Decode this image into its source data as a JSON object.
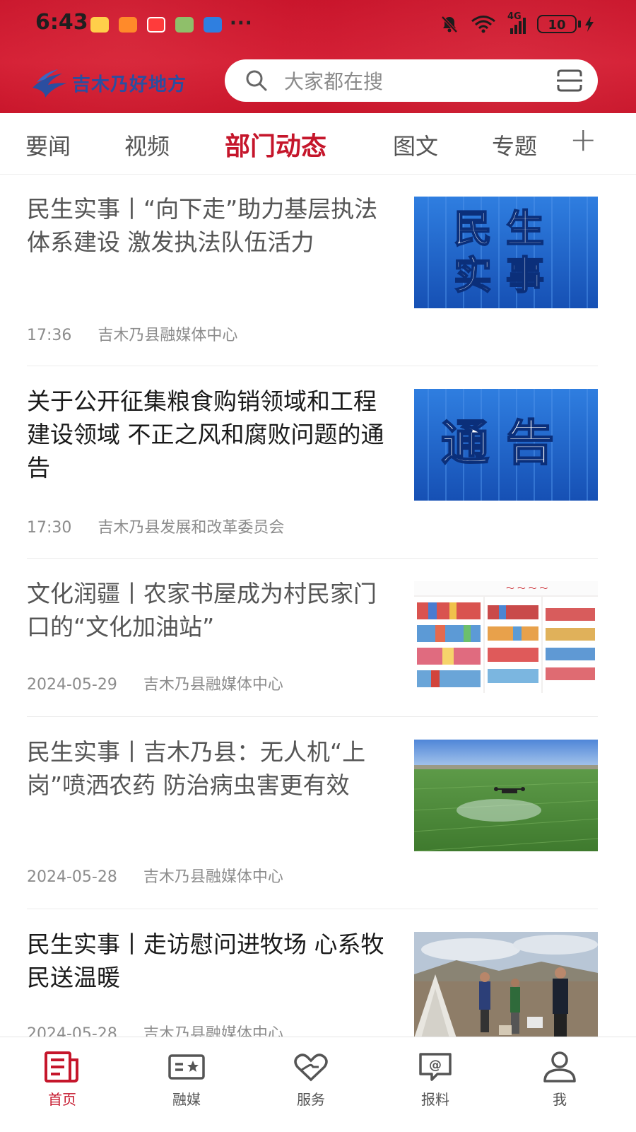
{
  "status_bar": {
    "time": "6:43",
    "more": "···",
    "network": "4G",
    "battery": "10"
  },
  "header": {
    "logo_text": "吉木乃好地方",
    "search_placeholder": "大家都在搜"
  },
  "tabs": [
    {
      "label": "要闻",
      "active": false
    },
    {
      "label": "视频",
      "active": false
    },
    {
      "label": "部门动态",
      "active": true
    },
    {
      "label": "图文",
      "active": false
    },
    {
      "label": "专题",
      "active": false
    }
  ],
  "tab_add": "+",
  "articles": [
    {
      "title": "民生实事丨“向下走”助力基层执法体系建设 激发执法队伍活力",
      "time": "17:36",
      "source": "吉木乃县融媒体中心",
      "thumb": {
        "type": "text-banner",
        "text": "民 生\n实 事"
      }
    },
    {
      "title": "关于公开征集粮食购销领域和工程建设领域 不正之风和腐败问题的通告",
      "time": "17:30",
      "source": "吉木乃县发展和改革委员会",
      "thumb": {
        "type": "text-banner",
        "text": "通 告"
      }
    },
    {
      "title": "文化润疆丨农家书屋成为村民家门口的“文化加油站”",
      "time": "2024-05-29",
      "source": "吉木乃县融媒体中心",
      "thumb": {
        "type": "photo",
        "subject": "bookshelves-photo"
      }
    },
    {
      "title": "民生实事丨吉木乃县：无人机“上岗”喷洒农药 防治病虫害更有效",
      "time": "2024-05-28",
      "source": "吉木乃县融媒体中心",
      "thumb": {
        "type": "photo",
        "subject": "drone-field-photo"
      }
    },
    {
      "title": "民生实事丨走访慰问进牧场 心系牧民送温暖",
      "time": "2024-05-28",
      "source": "吉木乃县融媒体中心",
      "thumb": {
        "type": "photo",
        "subject": "yurt-visit-photo"
      }
    }
  ],
  "bottom_nav": [
    {
      "label": "首页",
      "icon": "newspaper-icon",
      "active": true
    },
    {
      "label": "融媒",
      "icon": "media-card-icon",
      "active": false
    },
    {
      "label": "服务",
      "icon": "heart-hands-icon",
      "active": false
    },
    {
      "label": "报料",
      "icon": "at-chat-icon",
      "active": false
    },
    {
      "label": "我",
      "icon": "person-icon",
      "active": false
    }
  ],
  "colors": {
    "brand_red": "#c5162b",
    "header_red": "#d31d33",
    "banner_blue": "#1d62c8"
  }
}
